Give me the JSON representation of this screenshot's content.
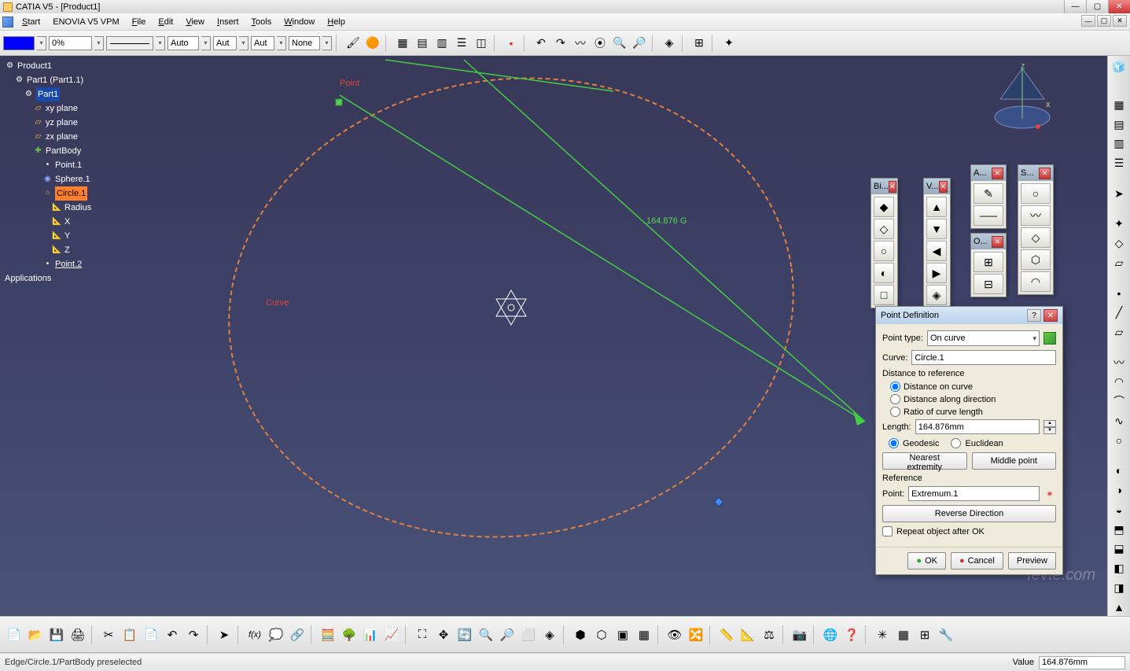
{
  "titlebar": {
    "text": "CATIA V5 - [Product1]"
  },
  "menu": {
    "start": "Start",
    "enovia": "ENOVIA V5 VPM",
    "file": "File",
    "edit": "Edit",
    "view": "View",
    "insert": "Insert",
    "tools": "Tools",
    "window": "Window",
    "help": "Help"
  },
  "toolbar": {
    "pct": "0%",
    "auto1": "Auto",
    "auto2": "Aut",
    "auto3": "Aut",
    "none": "None"
  },
  "tree": {
    "root": "Product1",
    "part1": "Part1 (Part1.1)",
    "part1b": "Part1",
    "xy": "xy plane",
    "yz": "yz plane",
    "zx": "zx plane",
    "partbody": "PartBody",
    "point1": "Point.1",
    "sphere1": "Sphere.1",
    "circle1": "Circle.1",
    "radius": "Radius",
    "x": "X",
    "y": "Y",
    "z": "Z",
    "point2": "Point.2",
    "applications": "Applications"
  },
  "viewport": {
    "dim": "164.876 G",
    "lbl_point": "Point",
    "lbl_curve": "Curve"
  },
  "float": {
    "bi": "Bi...",
    "v": "V...",
    "a": "A...",
    "s": "S...",
    "o": "O..."
  },
  "dialog": {
    "title": "Point Definition",
    "point_type_lbl": "Point type:",
    "point_type_val": "On curve",
    "curve_lbl": "Curve:",
    "curve_val": "Circle.1",
    "dist_ref": "Distance to reference",
    "opt_dist": "Distance on curve",
    "opt_dir": "Distance along direction",
    "opt_ratio": "Ratio of curve length",
    "length_lbl": "Length:",
    "length_val": "164.876mm",
    "geodesic": "Geodesic",
    "euclidean": "Euclidean",
    "nearest": "Nearest extremity",
    "middle": "Middle point",
    "reference": "Reference",
    "point_lbl": "Point:",
    "point_val": "Extremum.1",
    "reverse": "Reverse Direction",
    "repeat": "Repeat object after OK",
    "ok": "OK",
    "cancel": "Cancel",
    "preview": "Preview"
  },
  "status": {
    "left": "Edge/Circle.1/PartBody preselected",
    "val_lbl": "Value",
    "val": "164.876mm"
  },
  "watermark": "fevte.com"
}
